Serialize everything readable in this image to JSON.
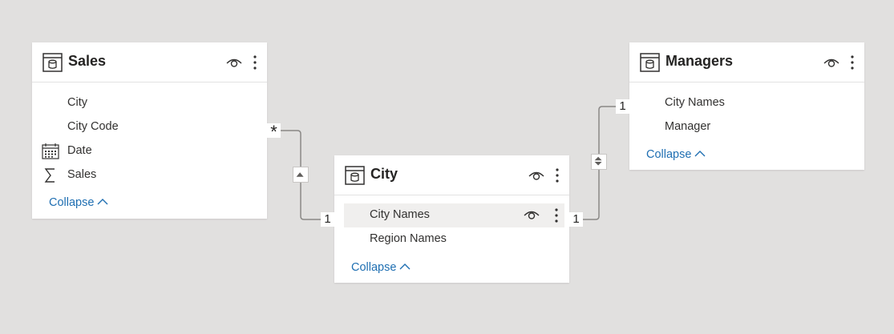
{
  "tables": {
    "sales": {
      "title": "Sales",
      "fields": [
        {
          "label": "City",
          "icon": ""
        },
        {
          "label": "City Code",
          "icon": ""
        },
        {
          "label": "Date",
          "icon": "calendar-icon"
        },
        {
          "label": "Sales",
          "icon": "sigma-icon"
        }
      ],
      "collapse_label": "Collapse"
    },
    "city": {
      "title": "City",
      "fields": [
        {
          "label": "City Names",
          "icon": "",
          "highlighted": true
        },
        {
          "label": "Region Names",
          "icon": ""
        }
      ],
      "collapse_label": "Collapse"
    },
    "managers": {
      "title": "Managers",
      "fields": [
        {
          "label": "City Names",
          "icon": ""
        },
        {
          "label": "Manager",
          "icon": ""
        }
      ],
      "collapse_label": "Collapse"
    }
  },
  "relationships": [
    {
      "from": "Sales",
      "to": "City",
      "from_cardinality": "*",
      "to_cardinality": "1",
      "cross_filter": "single"
    },
    {
      "from": "City",
      "to": "Managers",
      "from_cardinality": "1",
      "to_cardinality": "1",
      "cross_filter": "both"
    }
  ],
  "colors": {
    "canvas": "#e1e0df",
    "card": "#ffffff",
    "link": "#1f6fb2",
    "line": "#8a8886",
    "text": "#323130"
  }
}
